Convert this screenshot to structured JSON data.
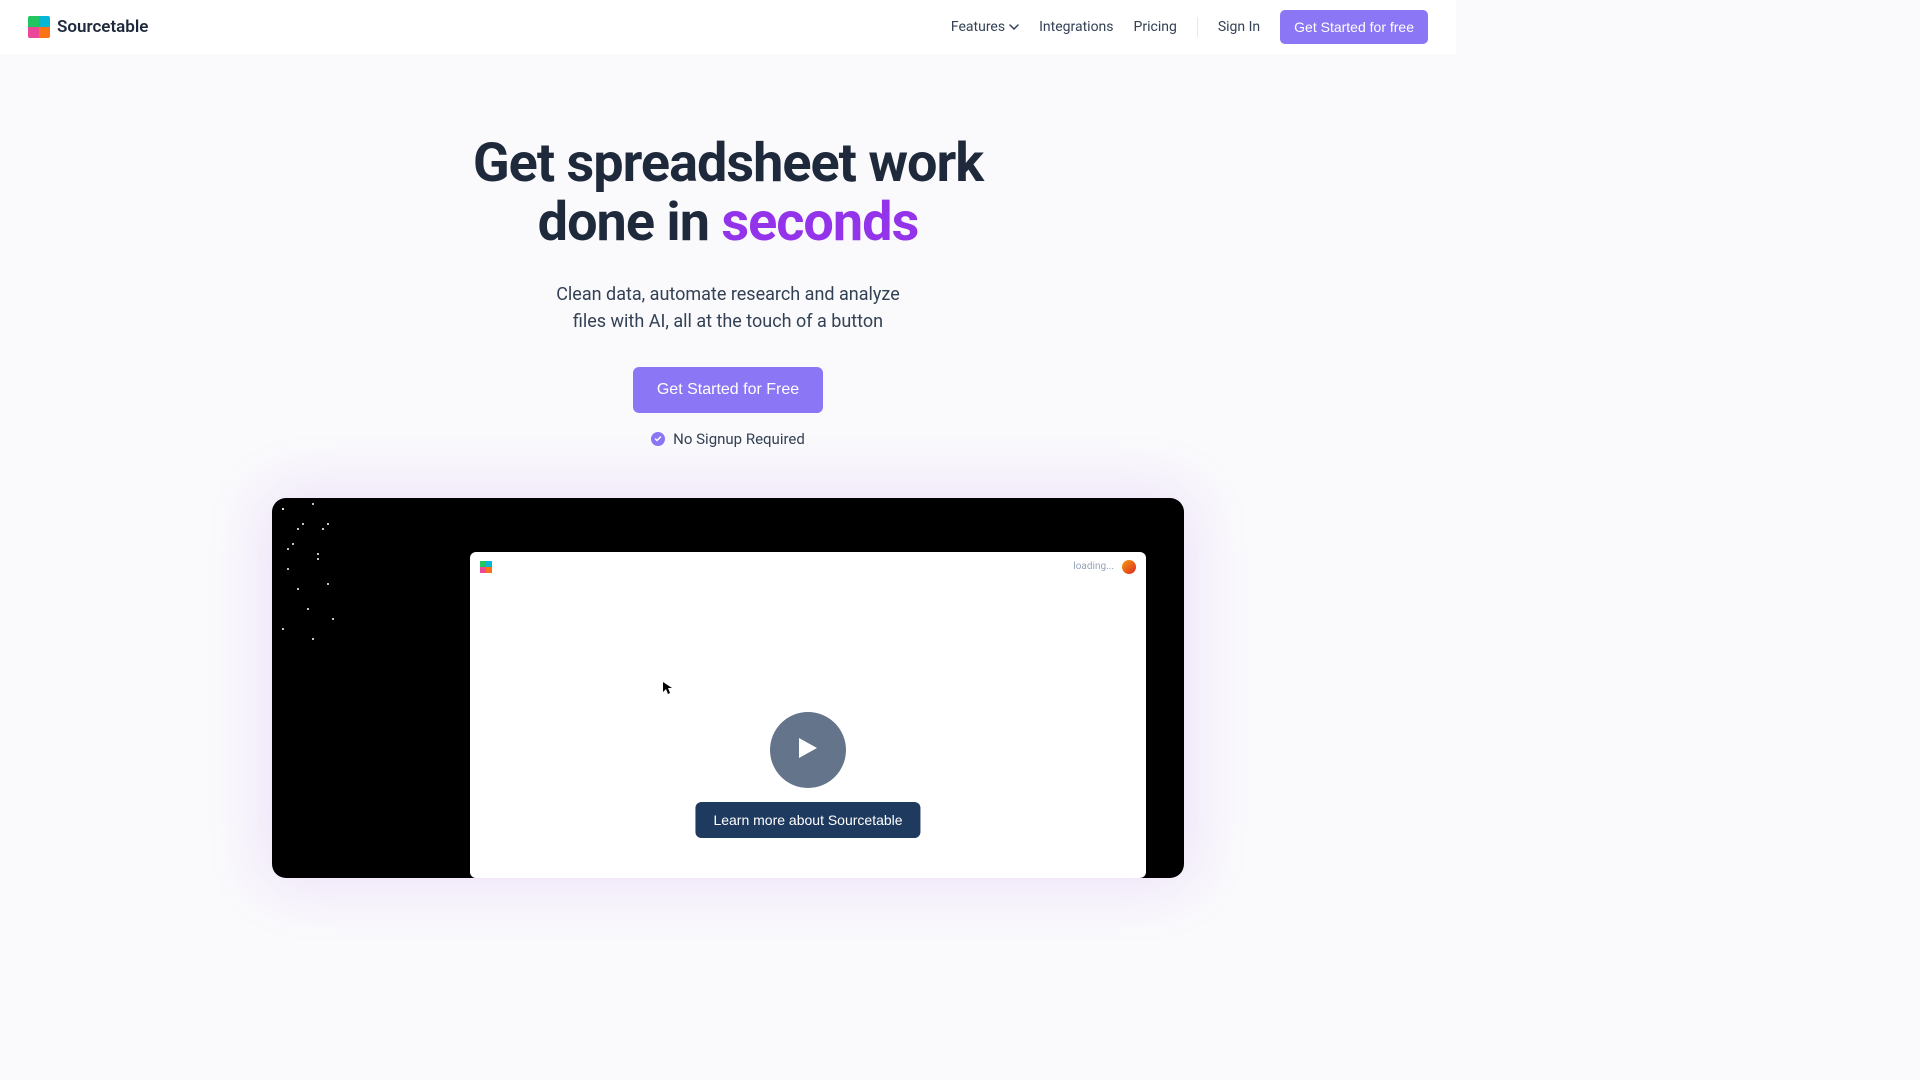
{
  "brand": {
    "name": "Sourcetable",
    "logo_colors": [
      "#22c55e",
      "#06b6d4",
      "#ec4899",
      "#f97316"
    ]
  },
  "nav": {
    "features": "Features",
    "integrations": "Integrations",
    "pricing": "Pricing",
    "signin": "Sign In",
    "cta": "Get Started for free"
  },
  "hero": {
    "title_line1": "Get spreadsheet work",
    "title_line2_prefix": "done in ",
    "title_highlight": "seconds",
    "subtitle_line1": "Clean data, automate research and analyze",
    "subtitle_line2": "files with AI, all at the touch of a button",
    "cta": "Get Started for Free",
    "no_signup": "No Signup Required"
  },
  "video": {
    "loading": "loading...",
    "learn_more": "Learn more about Sourcetable"
  },
  "colors": {
    "primary": "#8b76f5",
    "highlight": "#9333ea",
    "text": "#1e293b",
    "dark_button": "#1e3a5f"
  }
}
